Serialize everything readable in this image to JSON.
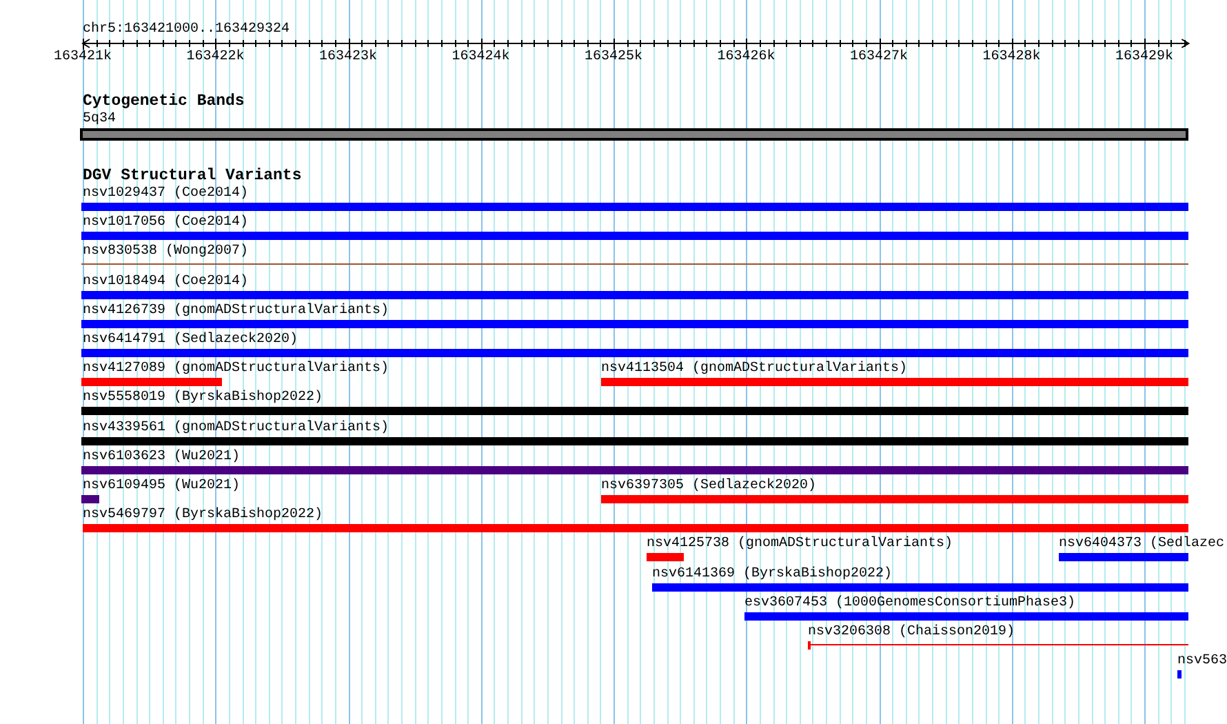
{
  "ruler": {
    "location": "chr5:163421000..163429324",
    "tick_labels": [
      "163421k",
      "163422k",
      "163423k",
      "163424k",
      "163425k",
      "163426k",
      "163427k",
      "163428k",
      "163429k"
    ]
  },
  "tracks": [
    {
      "title": "Cytogenetic Bands",
      "kind": "bands",
      "rows": [
        [
          {
            "label": "5q34",
            "kind": "band",
            "color": "#808080"
          }
        ]
      ]
    },
    {
      "title": "DGV Structural Variants",
      "kind": "variants",
      "rows": [
        [
          {
            "label": "nsv1029437 (Coe2014)",
            "kind": "bar",
            "color": "#0000ff"
          }
        ],
        [
          {
            "label": "nsv1017056 (Coe2014)",
            "kind": "bar",
            "color": "#0000ff"
          }
        ],
        [
          {
            "label": "nsv830538 (Wong2007)",
            "kind": "line",
            "color": "#a0522d"
          }
        ],
        [
          {
            "label": "nsv1018494 (Coe2014)",
            "kind": "bar",
            "color": "#0000ff"
          }
        ],
        [
          {
            "label": "nsv4126739 (gnomADStructuralVariants)",
            "kind": "bar",
            "color": "#0000ff"
          }
        ],
        [
          {
            "label": "nsv6414791 (Sedlazeck2020)",
            "kind": "bar",
            "color": "#0000ff"
          }
        ],
        [
          {
            "label": "nsv4127089 (gnomADStructuralVariants)",
            "kind": "bar",
            "color": "#ff0000"
          },
          {
            "label": "nsv4113504 (gnomADStructuralVariants)",
            "kind": "bar",
            "color": "#ff0000"
          }
        ],
        [
          {
            "label": "nsv5558019 (ByrskaBishop2022)",
            "kind": "bar",
            "color": "#000000"
          }
        ],
        [
          {
            "label": "nsv4339561 (gnomADStructuralVariants)",
            "kind": "bar",
            "color": "#000000"
          }
        ],
        [
          {
            "label": "nsv6103623 (Wu2021)",
            "kind": "bar",
            "color": "#4b0082"
          }
        ],
        [
          {
            "label": "nsv6109495 (Wu2021)",
            "kind": "bar",
            "color": "#4b0082"
          },
          {
            "label": "nsv6397305 (Sedlazeck2020)",
            "kind": "bar",
            "color": "#ff0000"
          }
        ],
        [
          {
            "label": "nsv5469797 (ByrskaBishop2022)",
            "kind": "bar",
            "color": "#ff0000"
          }
        ],
        [
          {
            "label": "nsv4125738 (gnomADStructuralVariants)",
            "kind": "bar",
            "color": "#ff0000"
          },
          {
            "label": "nsv6404373 (Sedlazec",
            "kind": "bar",
            "color": "#0000ff"
          }
        ],
        [
          {
            "label": "nsv6141369 (ByrskaBishop2022)",
            "kind": "bar",
            "color": "#0000ff"
          }
        ],
        [
          {
            "label": "esv3607453 (1000GenomesConsortiumPhase3)",
            "kind": "bar",
            "color": "#0000ff"
          }
        ],
        [
          {
            "label": "nsv3206308 (Chaisson2019)",
            "kind": "line",
            "color": "#ff0000"
          }
        ],
        [
          {
            "label": "nsv563",
            "kind": "bar",
            "color": "#0000ff"
          }
        ]
      ]
    }
  ]
}
